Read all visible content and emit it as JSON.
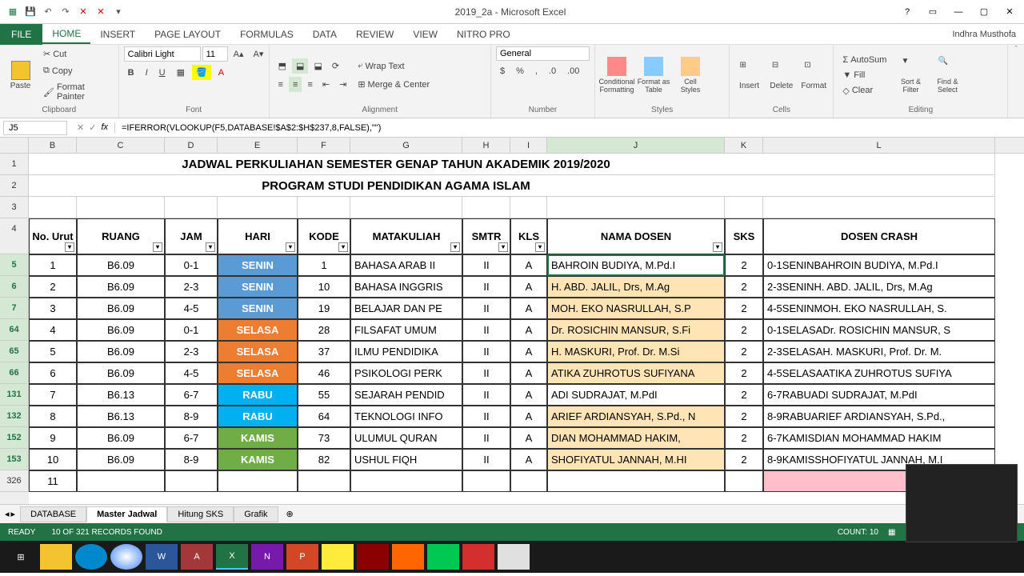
{
  "app": {
    "title": "2019_2a - Microsoft Excel"
  },
  "user": "Indhra Musthofa",
  "menu": {
    "file": "FILE",
    "tabs": [
      "HOME",
      "INSERT",
      "PAGE LAYOUT",
      "FORMULAS",
      "DATA",
      "REVIEW",
      "VIEW",
      "NITRO PRO"
    ],
    "active": 0
  },
  "ribbon": {
    "clipboard": {
      "label": "Clipboard",
      "paste": "Paste",
      "cut": "Cut",
      "copy": "Copy",
      "painter": "Format Painter"
    },
    "font": {
      "label": "Font",
      "name": "Calibri Light",
      "size": "11"
    },
    "alignment": {
      "label": "Alignment",
      "wrap": "Wrap Text",
      "merge": "Merge & Center"
    },
    "number": {
      "label": "Number",
      "format": "General"
    },
    "styles": {
      "label": "Styles",
      "cond": "Conditional Formatting",
      "fmt": "Format as Table",
      "cell": "Cell Styles"
    },
    "cells": {
      "label": "Cells",
      "insert": "Insert",
      "delete": "Delete",
      "format": "Format"
    },
    "editing": {
      "label": "Editing",
      "autosum": "AutoSum",
      "fill": "Fill",
      "clear": "Clear",
      "sort": "Sort & Filter",
      "find": "Find & Select"
    }
  },
  "namebox": "J5",
  "formula": "=IFERROR(VLOOKUP(F5,DATABASE!$A$2:$H$237,8,FALSE),\"\")",
  "cols": [
    "B",
    "C",
    "D",
    "E",
    "F",
    "G",
    "H",
    "I",
    "J",
    "K",
    "L"
  ],
  "title1": "JADWAL PERKULIAHAN SEMESTER GENAP TAHUN AKADEMIK 2019/2020",
  "title2": "PROGRAM STUDI PENDIDIKAN AGAMA ISLAM",
  "headers": {
    "b": "No. Urut",
    "c": "RUANG",
    "d": "JAM",
    "e": "HARI",
    "f": "KODE",
    "g": "MATAKULIAH",
    "h": "SMTR",
    "i": "KLS",
    "j": "NAMA DOSEN",
    "k": "SKS",
    "l": "DOSEN CRASH"
  },
  "rownums": [
    "1",
    "2",
    "3",
    "4",
    "5",
    "6",
    "7",
    "64",
    "65",
    "66",
    "131",
    "132",
    "152",
    "153",
    "326"
  ],
  "rows": [
    {
      "no": "1",
      "ruang": "B6.09",
      "jam": "0-1",
      "hari": "SENIN",
      "kode": "1",
      "mk": "BAHASA ARAB II",
      "smtr": "II",
      "kls": "A",
      "dosen": "BAHROIN BUDIYA, M.Pd.I",
      "sks": "2",
      "crash": "0-1SENINBAHROIN BUDIYA, M.Pd.I",
      "hc": "c-senin",
      "db": ""
    },
    {
      "no": "2",
      "ruang": "B6.09",
      "jam": "2-3",
      "hari": "SENIN",
      "kode": "10",
      "mk": "BAHASA INGGRIS",
      "smtr": "II",
      "kls": "A",
      "dosen": "H. ABD. JALIL, Drs, M.Ag",
      "sks": "2",
      "crash": "2-3SENINH. ABD. JALIL, Drs, M.Ag",
      "hc": "c-senin",
      "db": "dosen-bg"
    },
    {
      "no": "3",
      "ruang": "B6.09",
      "jam": "4-5",
      "hari": "SENIN",
      "kode": "19",
      "mk": "BELAJAR DAN PE",
      "smtr": "II",
      "kls": "A",
      "dosen": "MOH. EKO NASRULLAH, S.P",
      "sks": "2",
      "crash": "4-5SENINMOH. EKO NASRULLAH, S.",
      "hc": "c-senin",
      "db": "dosen-bg"
    },
    {
      "no": "4",
      "ruang": "B6.09",
      "jam": "0-1",
      "hari": "SELASA",
      "kode": "28",
      "mk": "FILSAFAT UMUM",
      "smtr": "II",
      "kls": "A",
      "dosen": "Dr. ROSICHIN MANSUR, S.Fi",
      "sks": "2",
      "crash": "0-1SELASADr. ROSICHIN MANSUR, S",
      "hc": "c-selasa",
      "db": "dosen-bg"
    },
    {
      "no": "5",
      "ruang": "B6.09",
      "jam": "2-3",
      "hari": "SELASA",
      "kode": "37",
      "mk": "ILMU PENDIDIKA",
      "smtr": "II",
      "kls": "A",
      "dosen": "H. MASKURI, Prof. Dr. M.Si",
      "sks": "2",
      "crash": "2-3SELASAH. MASKURI, Prof. Dr. M.",
      "hc": "c-selasa",
      "db": "dosen-bg"
    },
    {
      "no": "6",
      "ruang": "B6.09",
      "jam": "4-5",
      "hari": "SELASA",
      "kode": "46",
      "mk": "PSIKOLOGI PERK",
      "smtr": "II",
      "kls": "A",
      "dosen": "ATIKA ZUHROTUS SUFIYANA",
      "sks": "2",
      "crash": "4-5SELASAATIKA ZUHROTUS SUFIYA",
      "hc": "c-selasa",
      "db": "dosen-bg"
    },
    {
      "no": "7",
      "ruang": "B6.13",
      "jam": "6-7",
      "hari": "RABU",
      "kode": "55",
      "mk": "SEJARAH PENDID",
      "smtr": "II",
      "kls": "A",
      "dosen": "ADI SUDRAJAT, M.PdI",
      "sks": "2",
      "crash": "6-7RABUADI SUDRAJAT, M.PdI",
      "hc": "c-rabu",
      "db": ""
    },
    {
      "no": "8",
      "ruang": "B6.13",
      "jam": "8-9",
      "hari": "RABU",
      "kode": "64",
      "mk": "TEKNOLOGI INFO",
      "smtr": "II",
      "kls": "A",
      "dosen": "ARIEF ARDIANSYAH, S.Pd., N",
      "sks": "2",
      "crash": "8-9RABUARIEF ARDIANSYAH, S.Pd.,",
      "hc": "c-rabu",
      "db": "dosen-bg"
    },
    {
      "no": "9",
      "ruang": "B6.09",
      "jam": "6-7",
      "hari": "KAMIS",
      "kode": "73",
      "mk": "ULUMUL QURAN",
      "smtr": "II",
      "kls": "A",
      "dosen": "DIAN MOHAMMAD HAKIM,",
      "sks": "2",
      "crash": "6-7KAMISDIAN MOHAMMAD HAKIM",
      "hc": "c-kamis",
      "db": "dosen-bg"
    },
    {
      "no": "10",
      "ruang": "B6.09",
      "jam": "8-9",
      "hari": "KAMIS",
      "kode": "82",
      "mk": "USHUL FIQH",
      "smtr": "II",
      "kls": "A",
      "dosen": "SHOFIYATUL JANNAH, M.HI",
      "sks": "2",
      "crash": "8-9KAMISSHOFIYATUL JANNAH, M.I",
      "hc": "c-kamis",
      "db": "dosen-bg"
    },
    {
      "no": "11",
      "ruang": "",
      "jam": "",
      "hari": "",
      "kode": "",
      "mk": "",
      "smtr": "",
      "kls": "",
      "dosen": "",
      "sks": "",
      "crash": "",
      "hc": "",
      "db": ""
    }
  ],
  "sheets": [
    "DATABASE",
    "Master Jadwal",
    "Hitung SKS",
    "Grafik"
  ],
  "active_sheet": 1,
  "status": {
    "ready": "READY",
    "filter": "10 OF 321 RECORDS FOUND",
    "count": "COUNT: 10"
  }
}
